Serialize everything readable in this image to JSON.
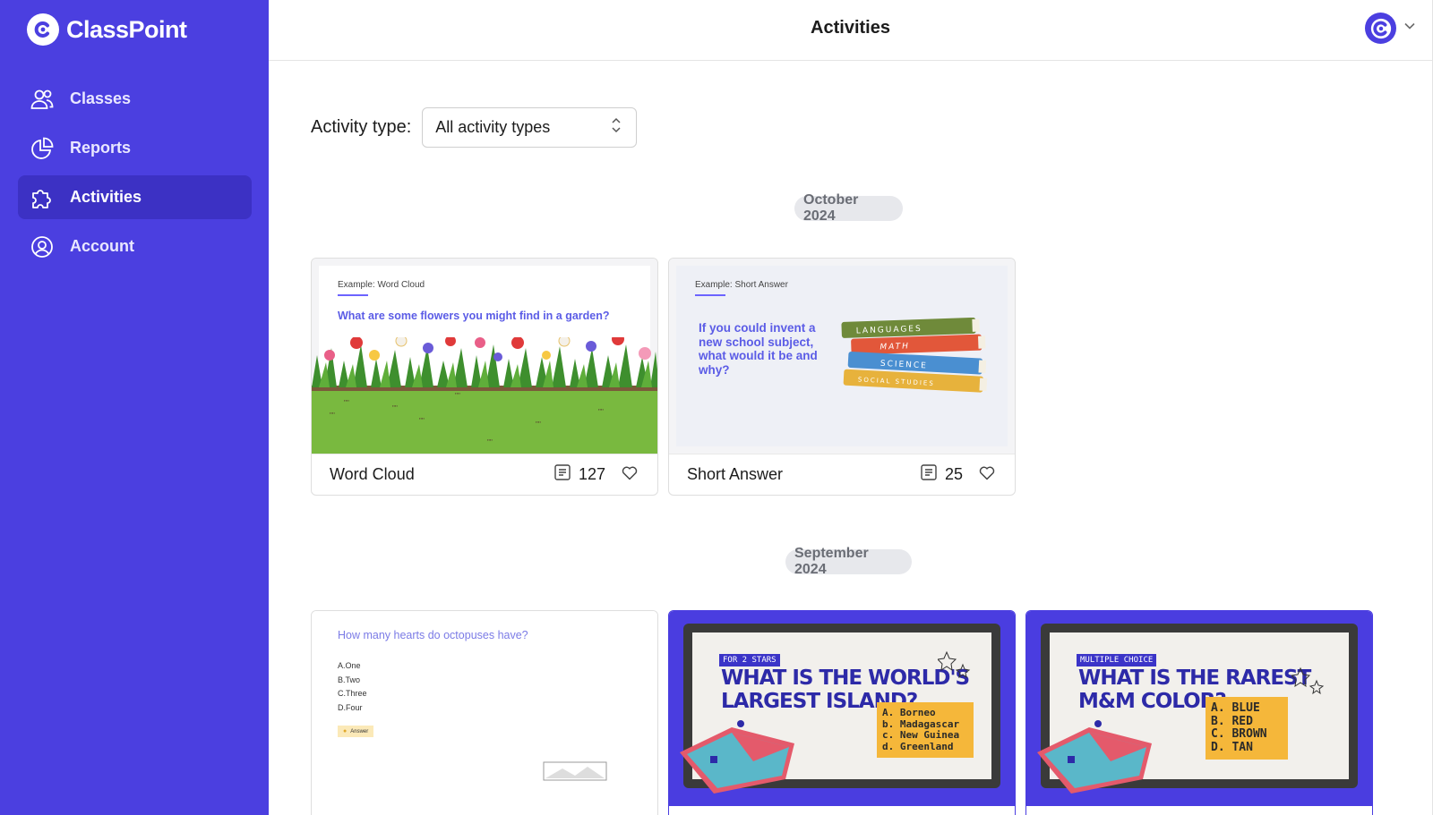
{
  "app": {
    "name": "ClassPoint"
  },
  "sidebar": {
    "items": [
      {
        "label": "Classes",
        "icon": "users-icon",
        "active": false
      },
      {
        "label": "Reports",
        "icon": "pie-chart-icon",
        "active": false
      },
      {
        "label": "Activities",
        "icon": "puzzle-icon",
        "active": true
      },
      {
        "label": "Account",
        "icon": "user-circle-icon",
        "active": false
      }
    ]
  },
  "header": {
    "title": "Activities"
  },
  "filter": {
    "label": "Activity type:",
    "selected": "All activity types"
  },
  "groups": [
    {
      "month": "October 2024",
      "cards": [
        {
          "title": "Word Cloud",
          "count": "127",
          "slide_caption": "Example: Word Cloud",
          "slide_question": "What are some flowers you might find in a garden?"
        },
        {
          "title": "Short Answer",
          "count": "25",
          "slide_caption": "Example: Short Answer",
          "slide_question": "If you could invent a new school subject, what would it be and why?",
          "books": [
            "LANGUAGES",
            "MATH",
            "SCIENCE",
            "SOCIAL STUDIES"
          ]
        }
      ]
    },
    {
      "month": "September 2024",
      "cards": [
        {
          "slide_question": "How many hearts do octopuses have?",
          "options": [
            "A.One",
            "B.Two",
            "C.Three",
            "D.Four"
          ],
          "answer_label": "Answer"
        },
        {
          "tag": "FOR 2 STARS",
          "poster_title_1": "WHAT IS THE WORLD'S",
          "poster_title_2": "LARGEST ISLAND?",
          "answers": [
            "A. Borneo",
            "b. Madagascar",
            "c. New Guinea",
            "d. Greenland"
          ]
        },
        {
          "tag": "MULTIPLE CHOICE",
          "poster_title_1": "WHAT IS THE RAREST",
          "poster_title_2": "M&M COLOR?",
          "answers": [
            "A. BLUE",
            "B. RED",
            "C. BROWN",
            "D. TAN"
          ]
        }
      ]
    }
  ],
  "colors": {
    "brand": "#4b3fe0",
    "sidebar_active": "#3c31c4",
    "pill_bg": "#e7e8ec",
    "slide_question": "#5b5ce6",
    "poster_bg": "#4a3de0",
    "answer_bg": "#f5b73a"
  }
}
